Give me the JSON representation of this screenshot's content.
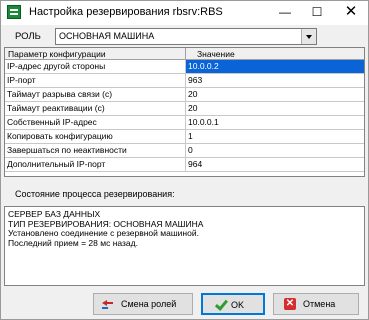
{
  "window": {
    "title": "Настройка резервирования rbsrv:RBS",
    "controls": {
      "minimize": "—",
      "maximize": "☐",
      "close": "✕"
    }
  },
  "role": {
    "label": "РОЛЬ",
    "value": "ОСНОВНАЯ МАШИНА"
  },
  "grid": {
    "columns": [
      "Параметр конфигурации",
      "Значение"
    ],
    "selected_row": 0,
    "rows": [
      {
        "param": "IP-адрес другой стороны",
        "value": "10.0.0.2"
      },
      {
        "param": "IP-порт",
        "value": "963"
      },
      {
        "param": "Таймаут разрыва связи (c)",
        "value": "20"
      },
      {
        "param": "Таймаут реактивации (с)",
        "value": "20"
      },
      {
        "param": "Собственный IP-адрес",
        "value": "10.0.0.1"
      },
      {
        "param": "Копировать конфигурацию",
        "value": "1"
      },
      {
        "param": "Завершаться по неактивности",
        "value": "0"
      },
      {
        "param": "Дополнительный IP-порт",
        "value": "964"
      }
    ]
  },
  "status": {
    "title": "Состояние процесса резервирования:",
    "lines": [
      "СЕРВЕР БАЗ ДАННЫХ",
      "ТИП РЕЗЕРВИРОВАНИЯ:   ОСНОВНАЯ МАШИНА",
      "Установлено соединение с резервной машиной.",
      "Последний прием = 28 мс назад."
    ]
  },
  "buttons": {
    "swap": {
      "label": "Смена ролей",
      "icon": "swap-arrows-icon"
    },
    "ok": {
      "label": "OK",
      "icon": "checkmark-icon"
    },
    "cancel": {
      "label": "Отмена",
      "icon": "cancel-x-icon"
    }
  },
  "colors": {
    "selection": "#0a64d8",
    "ok_border": "#0078d7"
  }
}
